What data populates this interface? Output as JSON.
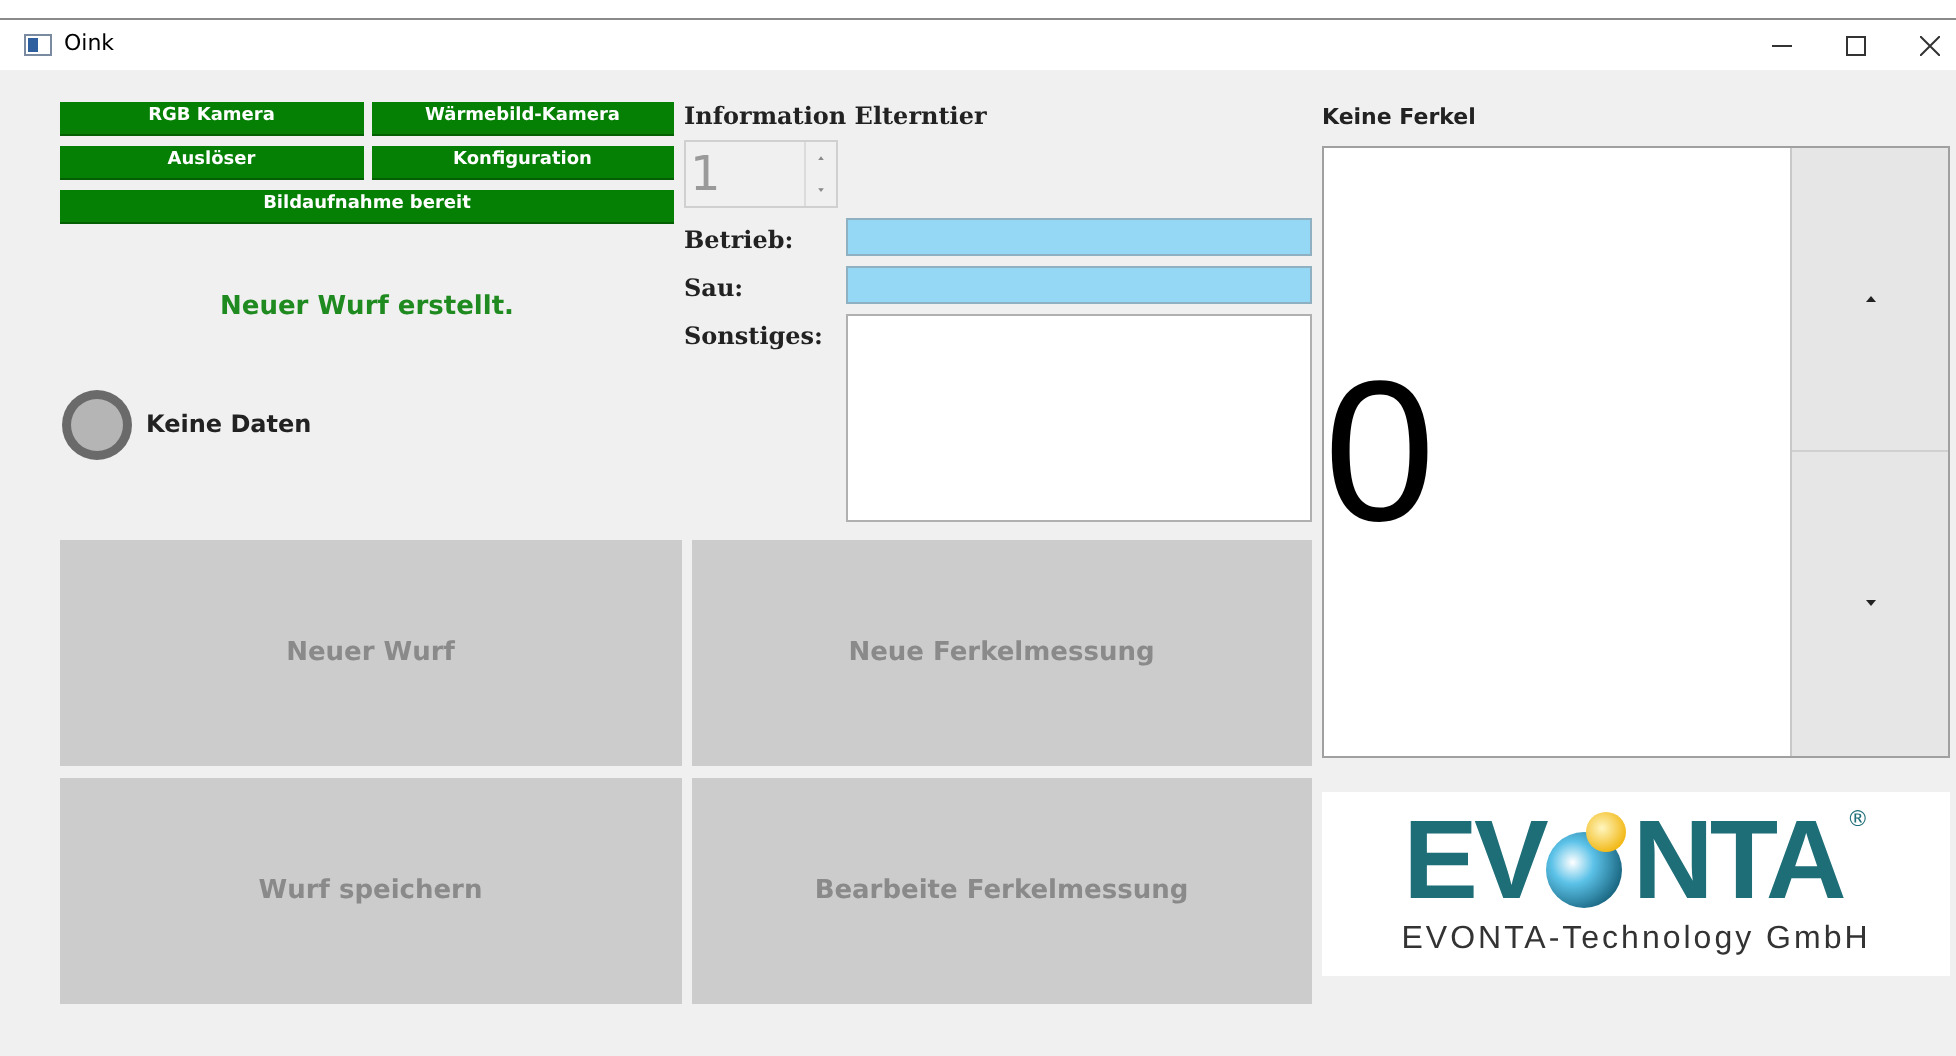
{
  "window": {
    "title": "Oink"
  },
  "device_buttons": [
    {
      "label": "RGB Kamera"
    },
    {
      "label": "Wärmebild-Kamera"
    },
    {
      "label": "Auslöser"
    },
    {
      "label": "Konfiguration"
    },
    {
      "label": "Bildaufnahme bereit",
      "wide": true
    }
  ],
  "status_message": "Neuer Wurf erstellt.",
  "indicator": {
    "label": "Keine Daten",
    "on": false
  },
  "parent_info": {
    "title": "Information Elterntier",
    "spinbox": {
      "value": "1",
      "disabled": true
    },
    "fields": [
      {
        "label": "Betrieb:",
        "kind": "line"
      },
      {
        "label": "Sau:",
        "kind": "line"
      },
      {
        "label": "Sonstiges:",
        "kind": "area"
      }
    ]
  },
  "piglets": {
    "title": "Keine Ferkel",
    "count": "0"
  },
  "action_buttons": [
    {
      "label": "Neuer Wurf",
      "disabled": true
    },
    {
      "label": "Neue Ferkelmessung",
      "disabled": true
    },
    {
      "label": "Wurf speichern",
      "disabled": true
    },
    {
      "label": "Bearbeite Ferkelmessung",
      "disabled": true
    }
  ],
  "logo": {
    "left": "EV",
    "right": "NTA",
    "registered": "®",
    "subtitle": "EVONTA-Technology GmbH"
  }
}
